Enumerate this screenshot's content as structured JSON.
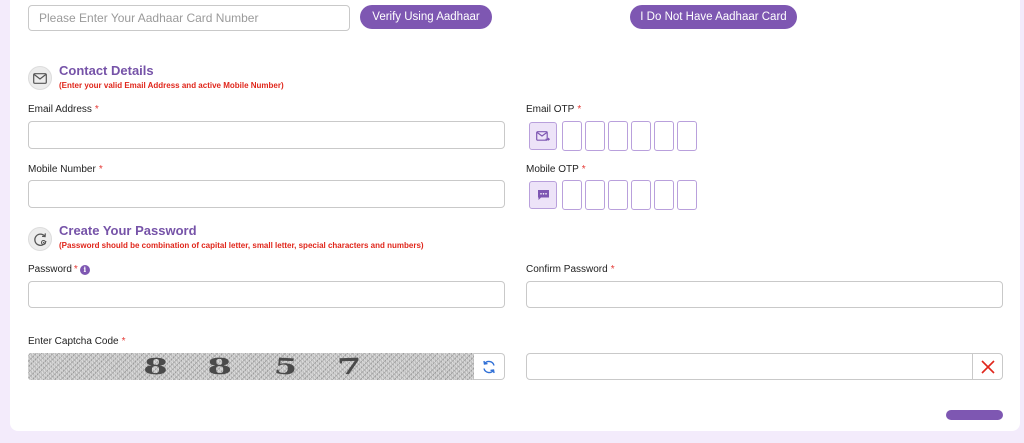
{
  "aadhaar": {
    "placeholder": "Please Enter Your Aadhaar Card Number",
    "value": "",
    "verify_label": "Verify Using Aadhaar",
    "no_aadhaar_label": "I Do Not Have Aadhaar Card"
  },
  "contact": {
    "title": "Contact Details",
    "note": "(Enter your valid Email Address and active Mobile Number)",
    "email_label": "Email Address",
    "email_otp_label": "Email OTP",
    "mobile_label": "Mobile Number",
    "mobile_otp_label": "Mobile OTP",
    "required_mark": "*"
  },
  "password": {
    "title": "Create Your Password",
    "note": "(Password should be combination of capital letter, small letter, special characters and numbers)",
    "password_label": "Password",
    "confirm_label": "Confirm Password",
    "info_icon": "i"
  },
  "captcha": {
    "label": "Enter Captcha Code",
    "characters": [
      "8",
      "8",
      "5",
      "7"
    ]
  },
  "icons": {
    "contact": "envelope-circle-icon",
    "password": "lock-reset-icon",
    "email_otp": "mail-send-icon",
    "mobile_otp": "chat-message-icon",
    "refresh": "refresh-icon",
    "clear": "close-icon"
  },
  "colors": {
    "accent": "#7e57b2",
    "title": "#7653a8",
    "note": "#e0261b",
    "required": "#e53935",
    "page_background": "#f3ebfb"
  }
}
